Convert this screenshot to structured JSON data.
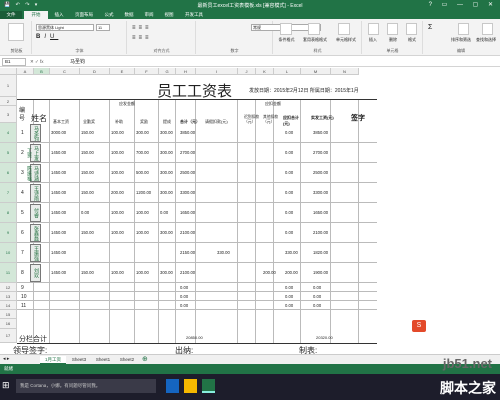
{
  "window": {
    "title": "最新员工excel工资表模板.xls [兼容模式] - Excel",
    "quick_access": "💾 ↶ ↷ ▾",
    "controls": "? ▭ — ▢ ✕"
  },
  "ribbon_tabs": [
    "文件",
    "开始",
    "插入",
    "页面布局",
    "公式",
    "数据",
    "审阅",
    "视图",
    "开发工具"
  ],
  "ribbon": {
    "font_name": "思源黑体 Light",
    "font_size": "11",
    "number_format": "常规",
    "groups": [
      "剪贴板",
      "字体",
      "对齐方式",
      "数字",
      "样式",
      "单元格",
      "编辑"
    ],
    "buttons": {
      "conditional_format": "条件格式",
      "format_table": "套用表格格式",
      "cell_styles": "单元格样式",
      "insert": "插入",
      "delete": "删除",
      "format": "格式",
      "sort": "排序和筛选",
      "find": "查找和选择"
    }
  },
  "formula_bar": {
    "name_box": "B1",
    "formula": "马圣钧"
  },
  "columns": [
    "A",
    "B",
    "C",
    "D",
    "E",
    "F",
    "G",
    "H",
    "I",
    "J",
    "K",
    "L",
    "M",
    "N"
  ],
  "rows": [
    "1",
    "2",
    "3",
    "4",
    "5",
    "6",
    "7",
    "8",
    "9",
    "10",
    "11",
    "12",
    "13",
    "14",
    "15",
    "16",
    "17"
  ],
  "sheet": {
    "title": "员工工资表",
    "issue_date": "发放日期：2015年2月12日 所属日期：2015年1月",
    "headers": {
      "no": "编号",
      "name": "姓名",
      "payable": "应发金额",
      "deduct": "应扣金额",
      "base": "基本工资",
      "seniority": "全勤奖",
      "subsidy": "补助",
      "overtime": "奖励",
      "bonus": "提成",
      "total": "合计（元）",
      "leave": "请假扣款(元)",
      "late": "迟到扣款（元）",
      "other": "其他扣款（元）",
      "deduct_total": "应扣合计(元)",
      "actual": "实发工资(元)",
      "sign": "签字"
    },
    "employees": [
      {
        "no": "1",
        "name": "马圣钧",
        "base": "3000.00",
        "seniority": "150.00",
        "subsidy": "100.00",
        "overtime": "300.00",
        "bonus": "300.00",
        "total": "3850.00",
        "leave": "",
        "late": "",
        "other": "",
        "deduct_total": "0.00",
        "actual": "3850.00"
      },
      {
        "no": "2",
        "name": "马上发工资",
        "base": "1450.00",
        "seniority": "150.00",
        "subsidy": "100.00",
        "overtime": "700.00",
        "bonus": "300.00",
        "total": "2700.00",
        "leave": "",
        "late": "",
        "other": "",
        "deduct_total": "0.00",
        "actual": "2700.00"
      },
      {
        "no": "3",
        "name": "马诗涵陈振福",
        "base": "1450.00",
        "seniority": "150.00",
        "subsidy": "100.00",
        "overtime": "500.00",
        "bonus": "300.00",
        "total": "2500.00",
        "leave": "",
        "late": "",
        "other": "",
        "deduct_total": "0.00",
        "actual": "2500.00"
      },
      {
        "no": "4",
        "name": "王诗雨",
        "base": "1450.00",
        "seniority": "150.00",
        "subsidy": "200.00",
        "overtime": "1200.00",
        "bonus": "300.00",
        "total": "3300.00",
        "leave": "",
        "late": "",
        "other": "",
        "deduct_total": "0.00",
        "actual": "3300.00"
      },
      {
        "no": "5",
        "name": "付睿",
        "base": "1450.00",
        "seniority": "0.00",
        "subsidy": "100.00",
        "overtime": "100.00",
        "bonus": "0.00",
        "total": "1650.00",
        "leave": "",
        "late": "",
        "other": "",
        "deduct_total": "0.00",
        "actual": "1650.00"
      },
      {
        "no": "6",
        "name": "张鑫磊",
        "base": "1450.00",
        "seniority": "150.00",
        "subsidy": "100.00",
        "overtime": "100.00",
        "bonus": "300.00",
        "total": "2100.00",
        "leave": "",
        "late": "",
        "other": "",
        "deduct_total": "0.00",
        "actual": "2100.00"
      },
      {
        "no": "7",
        "name": "王振强",
        "base": "1450.00",
        "seniority": "",
        "subsidy": "",
        "overtime": "",
        "bonus": "",
        "total": "2150.00",
        "leave": "330.00",
        "late": "",
        "other": "",
        "deduct_total": "330.00",
        "actual": "1820.00"
      },
      {
        "no": "8",
        "name": "刘欢",
        "base": "1450.00",
        "seniority": "150.00",
        "subsidy": "100.00",
        "overtime": "100.00",
        "bonus": "300.00",
        "total": "2100.00",
        "leave": "",
        "late": "",
        "other": "200.00",
        "deduct_total": "200.00",
        "actual": "1900.00"
      },
      {
        "no": "9",
        "name": "",
        "base": "",
        "seniority": "",
        "subsidy": "",
        "overtime": "",
        "bonus": "",
        "total": "0.00",
        "leave": "",
        "late": "",
        "other": "",
        "deduct_total": "0.00",
        "actual": "0.00"
      },
      {
        "no": "10",
        "name": "",
        "base": "",
        "seniority": "",
        "subsidy": "",
        "overtime": "",
        "bonus": "",
        "total": "0.00",
        "leave": "",
        "late": "",
        "other": "",
        "deduct_total": "0.00",
        "actual": "0.00"
      },
      {
        "no": "11",
        "name": "",
        "base": "",
        "seniority": "",
        "subsidy": "",
        "overtime": "",
        "bonus": "",
        "total": "0.00",
        "leave": "",
        "late": "",
        "other": "",
        "deduct_total": "0.00",
        "actual": "0.00"
      }
    ],
    "sum_label": "分栏合计",
    "sum_total": "20850.00",
    "sum_actual": "20320.00",
    "footer": {
      "leader": "领导签字:",
      "cashier": "出纳:",
      "maker": "制表:"
    }
  },
  "sheet_tabs": [
    "1月工资",
    "Sheet3",
    "Sheet1",
    "Sheet2"
  ],
  "status": {
    "ready": "就绪"
  },
  "taskbar": {
    "search": "我是 Cortana，小娜。有问题尽管问我。"
  },
  "watermark": {
    "site": "jb51.net",
    "logo": "脚本之家"
  },
  "colors": {
    "accent": "#217346",
    "taskbar": "#1d1d2b"
  }
}
